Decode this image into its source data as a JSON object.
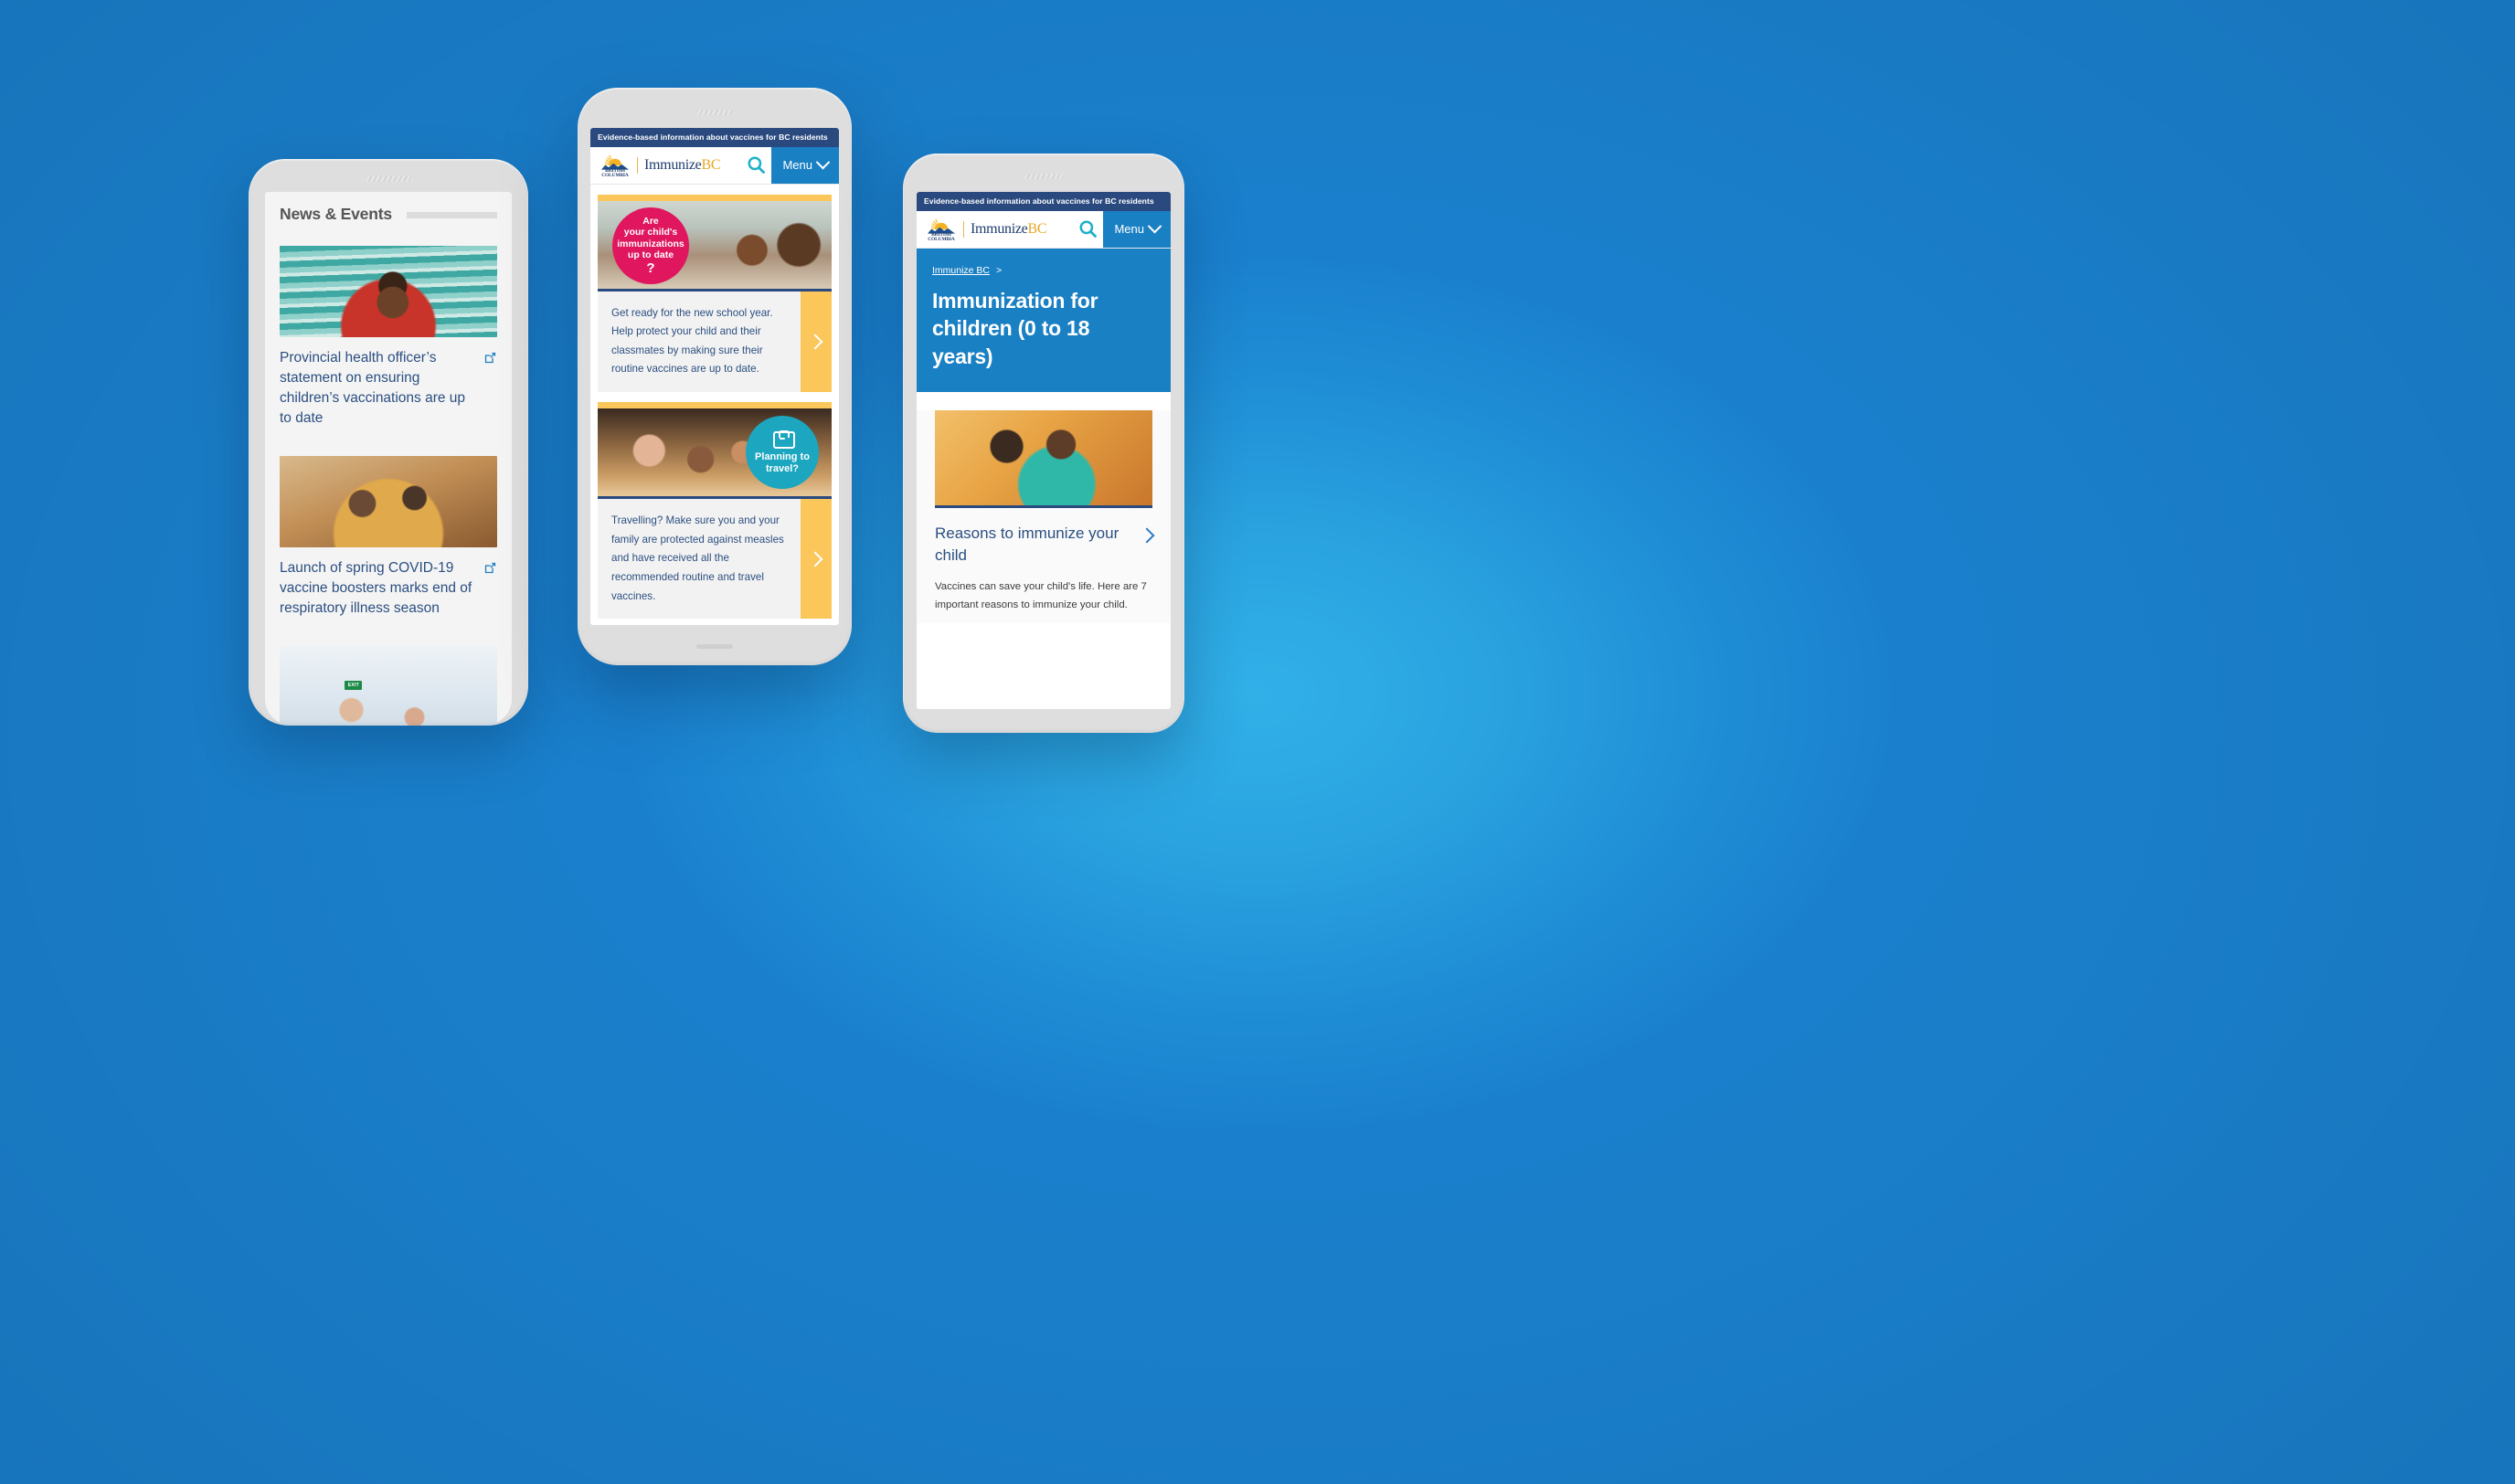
{
  "background": {
    "base_color": "#1a80ce",
    "glow_color": "#31b0e8"
  },
  "brand": {
    "eyebrow": "Evidence-based information about vaccines for BC residents",
    "logo_line1": "BRITISH",
    "logo_line2": "COLUMBIA",
    "name_part1": "Immunize",
    "name_part2": "BC",
    "menu_label": "Menu",
    "accent_blue": "#1a80c4",
    "accent_yellow": "#fbc65a",
    "accent_navy": "#2a4a7f"
  },
  "left_phone": {
    "section_title": "News & Events",
    "articles": [
      {
        "image_alt": "Smiling child giving thumbs up in front of teal stairs",
        "headline": "Provincial health officer’s statement on ensuring children’s vaccinations are up to date"
      },
      {
        "image_alt": "Family sitting on a sofa with a laptop",
        "headline": "Launch of spring COVID-19 vaccine boosters marks end of respiratory illness season"
      },
      {
        "image_alt": "People in a bright airport terminal with an EXIT sign",
        "exit_sign": "EXIT",
        "headline": ""
      }
    ]
  },
  "center_phone": {
    "cards": [
      {
        "badge_lines": [
          "Are",
          "your child's",
          "immunizations",
          "up to date"
        ],
        "badge_mark": "?",
        "badge_color": "#e0175e",
        "image_alt": "Two school children smiling outside a school",
        "body": "Get ready for the new school year. Help protect your child and their classmates by making sure their routine vaccines are up to date.",
        "arrow": "chevron-right"
      },
      {
        "badge_lines": [
          "Planning to",
          "travel?"
        ],
        "badge_icon": "suitcase-icon",
        "badge_color": "#1ca6bf",
        "image_alt": "Family of three smiling at an airport",
        "body": "Travelling? Make sure you and your family are protected against measles and have received all the recommended routine and travel vaccines.",
        "arrow": "chevron-right"
      }
    ]
  },
  "right_phone": {
    "breadcrumb_link": "Immunize BC",
    "breadcrumb_separator": ">",
    "page_title": "Immunization for children (0 to 18 years)",
    "image_alt": "Mother holding her young child, smiling",
    "link_title": "Reasons to immunize your child",
    "description": "Vaccines can save your child's life. Here are 7 important reasons to immunize your child."
  }
}
